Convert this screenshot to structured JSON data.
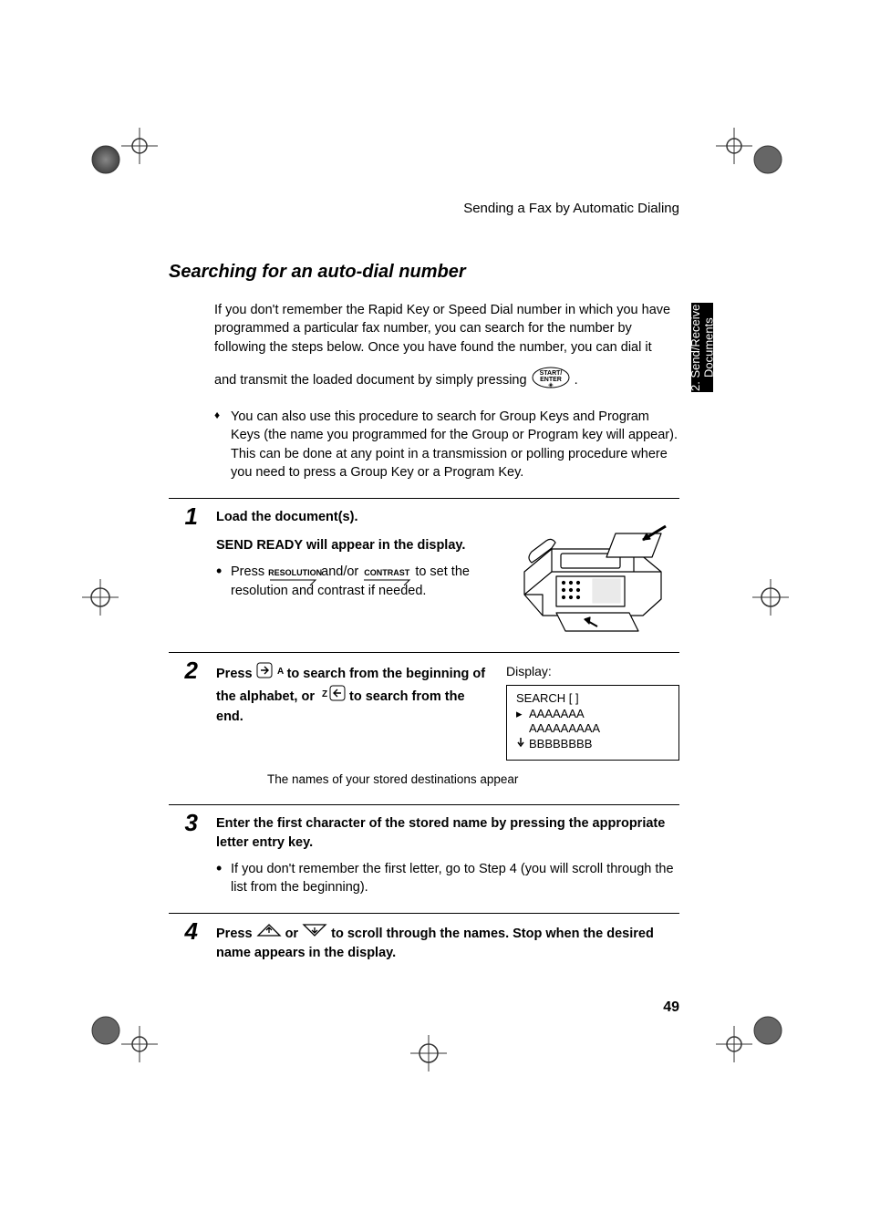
{
  "header": "Sending a Fax by Automatic Dialing",
  "tab": "2. Send/Receive Documents",
  "section_title": "Searching for an auto-dial number",
  "intro_p1": "If you don't remember the Rapid Key or Speed Dial number in which you have programmed a particular fax number, you can search for the number by following the steps below. Once you have found the number, you can dial it",
  "intro_inline_before": "and transmit the loaded document by simply pressing ",
  "intro_inline_after": " .",
  "enter_key_line1": "START/",
  "enter_key_line2": "ENTER",
  "intro_bullet": "You can also use this procedure to search for Group Keys and Program Keys (the name you programmed for the Group or Program key will appear). This can be done at any point in a transmission or polling procedure where you need to press a Group Key or a Program Key.",
  "step1": {
    "num": "1",
    "line1": "Load the document(s).",
    "line2": "SEND READY will appear in the display.",
    "press_label": "Press ",
    "key1_label": "RESOLUTION",
    "mid_text": " and/or ",
    "key2_label": "CONTRAST",
    "tail": " to set the resolution and contrast if needed."
  },
  "step2": {
    "num": "2",
    "seg_a": "Press ",
    "a_label": "A",
    "seg_b": " to search from the beginning of the alphabet, or ",
    "z_label": "Z",
    "seg_c": " to search from the end.",
    "caption": "The names of your stored destinations appear",
    "display_label": "Display:",
    "d_line1": "SEARCH [    ]",
    "d_line2": "AAAAAAA",
    "d_line3": "AAAAAAAAA",
    "d_line4": "BBBBBBBB"
  },
  "step3": {
    "num": "3",
    "bold": "Enter the first character of the stored name by pressing the appropriate letter entry key.",
    "bullet": "If you don't remember the first letter, go to Step 4 (you will scroll through the list from the beginning)."
  },
  "step4": {
    "num": "4",
    "seg_a": "Press ",
    "seg_b": " or ",
    "seg_c": " to scroll through the names. Stop when the desired name appears in the display."
  },
  "page_number": "49"
}
